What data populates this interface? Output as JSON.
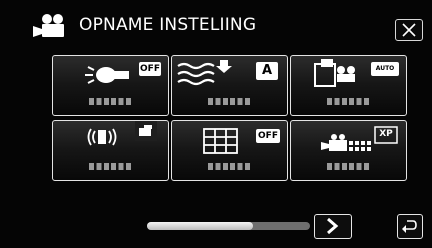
{
  "header": {
    "title": "OPNAME INSTELIING",
    "mode_icon": "video-camera-icon",
    "close_icon": "close-icon"
  },
  "tiles": [
    {
      "name": "tile-backlight",
      "icon": "backlight-lamp-icon",
      "badge": "OFF"
    },
    {
      "name": "tile-wind-cut",
      "icon": "wind-cut-icon",
      "badge": "A"
    },
    {
      "name": "tile-focus-assist",
      "icon": "face-priority-icon",
      "badge": "AUTO"
    },
    {
      "name": "tile-image-stabilizer",
      "icon": "image-stabilizer-icon",
      "badge": ""
    },
    {
      "name": "tile-grid",
      "icon": "grid-icon",
      "badge": "OFF"
    },
    {
      "name": "tile-video-quality",
      "icon": "video-quality-icon",
      "badge": "XP"
    }
  ],
  "scrollbar": {
    "position": 0.65
  },
  "footer": {
    "next_icon": "chevron-right-icon",
    "back_icon": "return-icon"
  },
  "colors": {
    "background": "#050505",
    "tile_border": "#e4e4e4",
    "text": "#ffffff"
  }
}
